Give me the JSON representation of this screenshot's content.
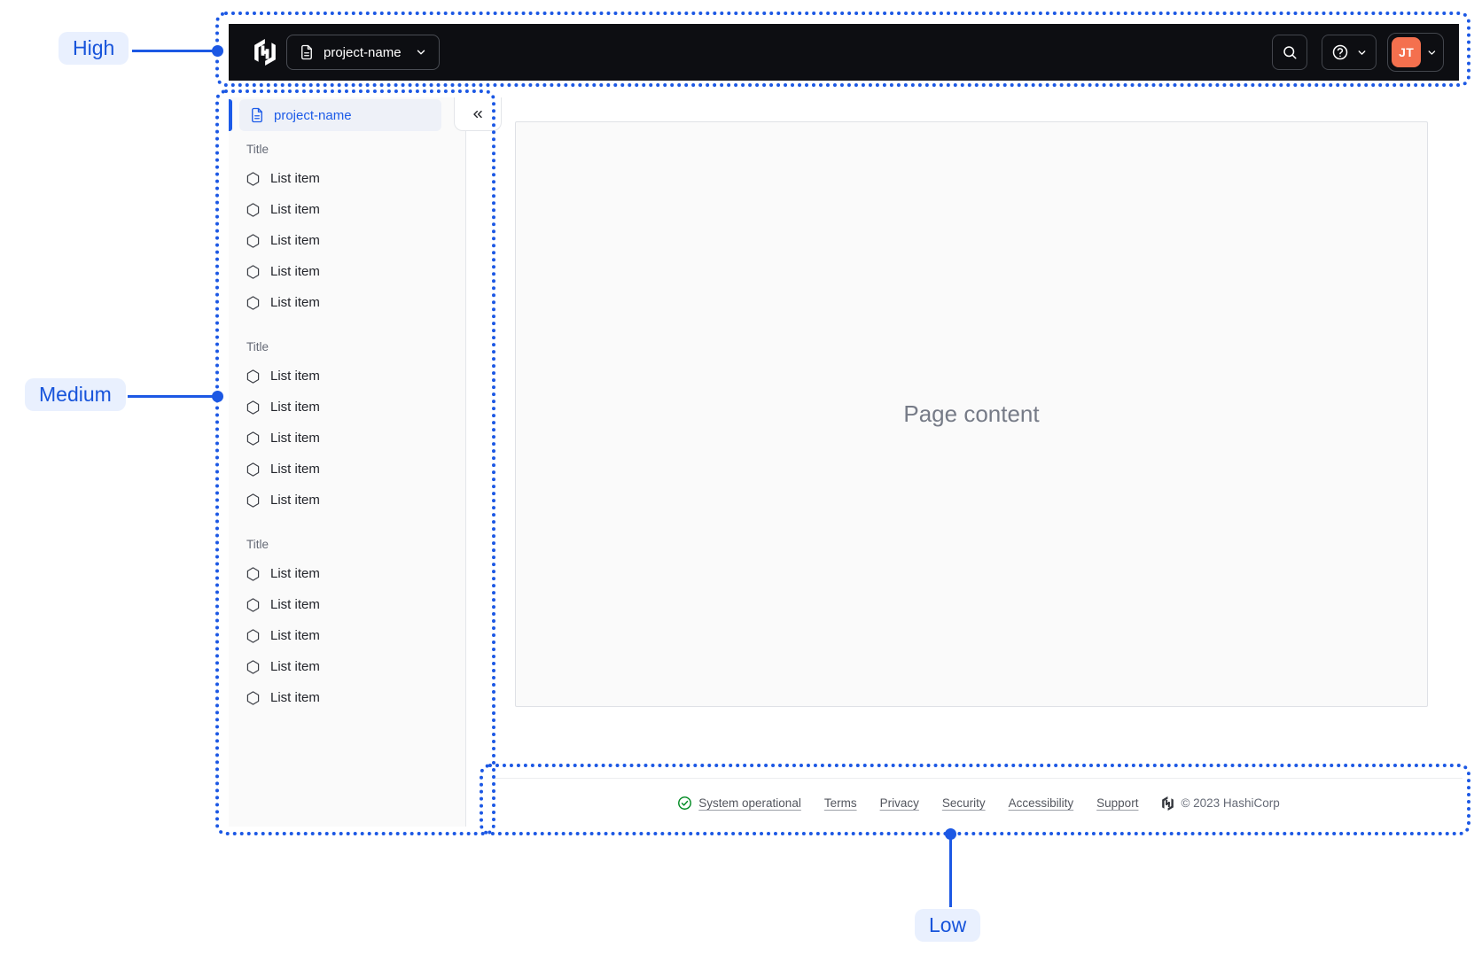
{
  "colors": {
    "annotation_blue": "#1C58E4",
    "annotation_label_bg": "#E9F0FE",
    "navbar_bg": "#0D0E12",
    "avatar_orange": "#F4704E",
    "active_item_blue": "#1C5BE8",
    "success_green": "#008A22",
    "surface_faint": "#FAFAFA"
  },
  "annotations": {
    "high": "High",
    "medium": "Medium",
    "low": "Low"
  },
  "navbar": {
    "project_switcher_label": "project-name",
    "icons": [
      "hashicorp-logo",
      "file-text-icon",
      "chevron-down-icon",
      "search-icon",
      "help-icon"
    ]
  },
  "user": {
    "initials": "JT"
  },
  "sidebar": {
    "header_label": "project-name",
    "header_icon": "file-text-icon",
    "collapse_icon": "collapse-double-chevron-left-icon",
    "item_icon": "hexagon-icon",
    "sections": [
      {
        "title": "Title",
        "items": [
          "List item",
          "List item",
          "List item",
          "List item",
          "List item"
        ]
      },
      {
        "title": "Title",
        "items": [
          "List item",
          "List item",
          "List item",
          "List item",
          "List item"
        ]
      },
      {
        "title": "Title",
        "items": [
          "List item",
          "List item",
          "List item",
          "List item",
          "List item"
        ]
      }
    ]
  },
  "main": {
    "placeholder": "Page content"
  },
  "footer": {
    "status_icon": "check-circle-icon",
    "status_label": "System operational",
    "links": [
      "Terms",
      "Privacy",
      "Security",
      "Accessibility",
      "Support"
    ],
    "logo_icon": "hashicorp-logo",
    "copyright": "© 2023 HashiCorp"
  }
}
